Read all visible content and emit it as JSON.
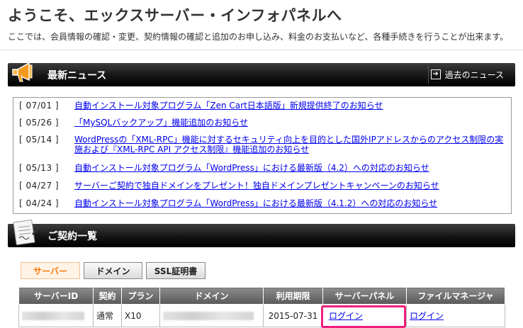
{
  "header": {
    "title": "ようこそ、エックスサーバー・インフォパネルへ",
    "description": "ここでは、会員情報の確認・変更、契約情報の確認と追加のお申し込み、料金のお支払いなど、各種手続きを行うことが出来ます。"
  },
  "news": {
    "title": "最新ニュース",
    "past_link": "過去のニュース",
    "items": [
      {
        "date": "[ 07/01 ]",
        "text": "自動インストール対象プログラム「Zen Cart日本語版」新規提供終了のお知らせ"
      },
      {
        "date": "[ 05/26 ]",
        "text": "「MySQLバックアップ」機能追加のお知らせ"
      },
      {
        "date": "[ 05/14 ]",
        "text": "WordPressの「XML-RPC」機能に対するセキュリティ向上を目的とした国外IPアドレスからのアクセス制限の実",
        "text2": "施および『XML-RPC API アクセス制限』機能追加のお知らせ"
      },
      {
        "date": "[ 05/13 ]",
        "text": "自動インストール対象プログラム「WordPress」における最新版（4.2）への対応のお知らせ"
      },
      {
        "date": "[ 04/27 ]",
        "text": "サーバーご契約で独自ドメインをプレゼント！独自ドメインプレゼントキャンペーンのお知らせ"
      },
      {
        "date": "[ 04/24 ]",
        "text": "自動インストール対象プログラム「WordPress」における最新版（4.1.2）への対応のお知らせ"
      }
    ]
  },
  "contracts": {
    "title": "ご契約一覧",
    "tabs": [
      "サーバー",
      "ドメイン",
      "SSL証明書"
    ],
    "active_tab": "サーバー",
    "columns": [
      "サーバーID",
      "契約",
      "プラン",
      "ドメイン",
      "利用期限",
      "サーバーパネル",
      "ファイルマネージャ"
    ],
    "rows": [
      {
        "contract": "通常",
        "plan": "X10",
        "expires": "2015-07-31",
        "server_panel": "ログイン",
        "file_manager": "ログイン"
      }
    ]
  },
  "colors": {
    "accent_orange": "#ff7700",
    "highlight_pink": "#ef1f7d",
    "link_blue": "#0000ee"
  }
}
